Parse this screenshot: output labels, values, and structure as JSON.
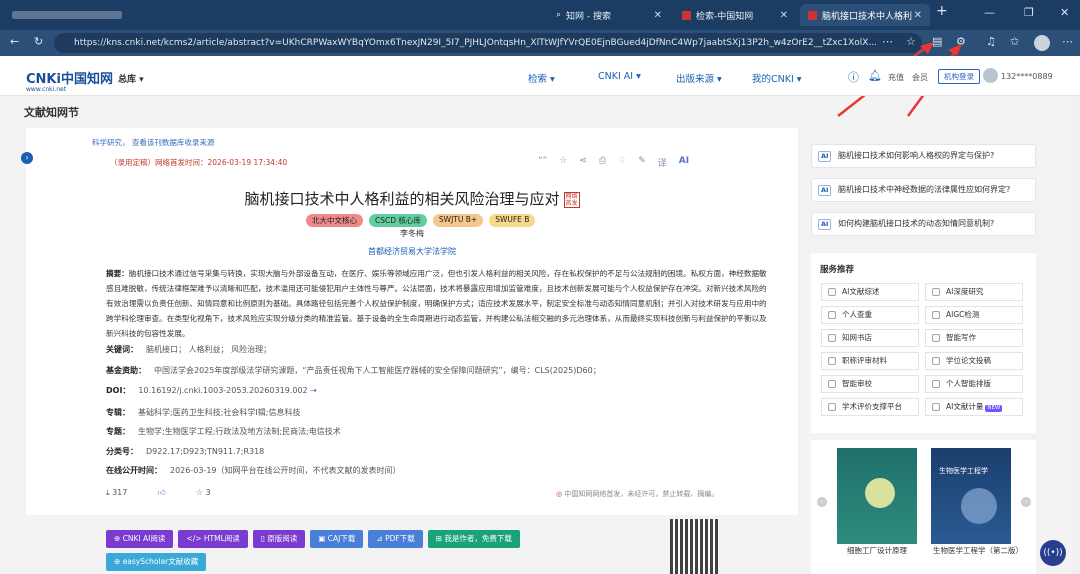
{
  "browser": {
    "tabs": [
      {
        "label": "",
        "active": false
      },
      {
        "label": "知网 - 搜索",
        "active": false
      },
      {
        "label": "检索-中国知网",
        "active": false
      },
      {
        "label": "脑机接口技术中人格利",
        "active": true
      }
    ],
    "url": "https://kns.cnki.net/kcms2/article/abstract?v=UKhCRPWaxWYBqYOmx6TnexJN29I_5I7_PJHLJOntqsHn_XlTtWJfYVrQE0EjnBGued4jDfNnC4Wp7jaabtSXj13P2h_w4zOrE2__tZxc1XolX..."
  },
  "site": {
    "logo": "CNKi中国知网",
    "logo_sub": "www.cnki.net",
    "lib": "总库",
    "nav": [
      "检索",
      "CNKI AI",
      "出版来源",
      "我的CNKI"
    ],
    "recharge": "充值",
    "member": "会员",
    "institution_login": "机构登录",
    "user": "132****0889"
  },
  "page_title": "文献知网节",
  "article": {
    "crumbs": "科学研究，   查看该刊数据库收录来源",
    "pub_status": "（录用定稿）网络首发时间：2026-03-19 17:34:40",
    "title": "脑机接口技术中人格利益的相关风险治理与应对",
    "title_tag": "网络首发",
    "badges": [
      "北大中文核心",
      "CSCD 核心库",
      "SWJTU B+",
      "SWUFE B"
    ],
    "author": "李冬梅",
    "org": "首都经济贸易大学法学院",
    "abstract_label": "摘要：",
    "abstract": "脑机接口技术通过信号采集与转换，实现大脑与外部设备互动，在医疗、娱乐等领域应用广泛，但也引发人格利益的相关风险，存在私权保护的不足与公法规制的困境。私权方面，神经数据敏感且难脱敏，传统法律框架难予以清晰和匹配，技术滥用还可能侵犯用户主体性与尊严。公法层面，技术将暴露应用增加监管难度，且技术创新发展可能与个人权益保护存在冲突。对新兴技术风险的有效治理需以负责任创新、知情同意和比例原则为基础。具体路径包括完善个人权益保护制度，明确保护方式；适应技术发展水平，制定安全标准与动态知情同意机制；并引入对技术研发与应用中的跨学科伦理审查。在类型化视角下，技术风险应实现分级分类的精准监管。基于设备的全生命周期进行动态监管，并构建公私法相交融的多元治理体系，从而最终实现科技创新与利益保护的平衡以及新兴科技的包容性发展。",
    "keywords_label": "关键词：",
    "keywords": "脑机接口；  人格利益；  风险治理；",
    "fund_label": "基金资助：",
    "fund": "中国法学会2025年度部级法学研究课题，“产品责任视角下人工智能医疗器械的安全保障问题研究”，编号：CLS(2025)D60；",
    "doi_label": "DOI：",
    "doi": "10.16192/j.cnki.1003-2053.20260319.002",
    "series_label": "专辑：",
    "series": "基础科学;医药卫生科技;社会科学Ⅰ辑;信息科技",
    "topic_label": "专题：",
    "topic": "生物学;生物医学工程;行政法及地方法制;民商法;电信技术",
    "class_label": "分类号：",
    "class": "D922.17;D923;TN911.7;R318",
    "online_label": "在线公开时间：",
    "online": "2026-03-19（知网平台在线公开时间，不代表文献的发表时间）",
    "downloads": "317",
    "favorites": "3",
    "copyright": "中国知网网络首发，未经许可，禁止转载、摘编。"
  },
  "actions": [
    "CNKI AI阅读",
    "HTML阅读",
    "原版阅读",
    "CAJ下载",
    "PDF下载",
    "我是作者，免费下载",
    "easyScholar文献收藏"
  ],
  "ai_questions": [
    "脑机接口技术如何影响人格权的界定与保护?",
    "脑机接口技术中神经数据的法律属性应如何界定?",
    "如何构建脑机接口技术的动态知情同意机制?"
  ],
  "ai_tag": "AI",
  "services": {
    "title": "服务推荐",
    "items": [
      "AI文献综述",
      "AI深度研究",
      "个人查重",
      "AIGC检测",
      "知网书店",
      "智能写作",
      "职称评审材料",
      "学位论文投稿",
      "智能审校",
      "个人智能排版",
      "学术评价支撑平台",
      "AI文献计量"
    ],
    "new_tag": "NEW"
  },
  "books": [
    "细胞工厂设计原理",
    "生物医学工程学（第二版）"
  ],
  "book_cover_title": "生物医学工程学",
  "colors": {
    "badge1": "#f08a8a",
    "badge2": "#5fcfa0",
    "badge3": "#f6c68a",
    "badge4": "#f6d98a",
    "btn_ai": "#7a3bd1",
    "btn_html": "#7a3bd1",
    "btn_orig": "#7a3bd1",
    "btn_caj": "#4a7fd9",
    "btn_pdf": "#4a7fd9",
    "btn_author": "#1aa37a",
    "btn_easy": "#3aa8d8"
  }
}
